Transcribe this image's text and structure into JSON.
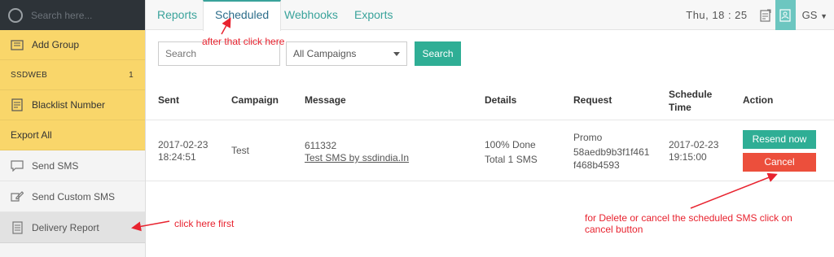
{
  "sidebar": {
    "search_placeholder": "Search here...",
    "add_group": "Add Group",
    "group_name": "SSDWEB",
    "group_count": "1",
    "blacklist": "Blacklist Number",
    "export_all": "Export All",
    "send_sms": "Send SMS",
    "send_custom_sms": "Send Custom SMS",
    "delivery_report": "Delivery Report"
  },
  "tabs": [
    "Reports",
    "Scheduled",
    "Webhooks",
    "Exports"
  ],
  "header": {
    "clock": "Thu, 18 : 25",
    "user": "GS"
  },
  "filters": {
    "search_placeholder": "Search",
    "campaign_select": "All Campaigns",
    "search_button": "Search"
  },
  "table": {
    "headers": {
      "sent": "Sent",
      "campaign": "Campaign",
      "message": "Message",
      "details": "Details",
      "request": "Request",
      "schedule_line1": "Schedule",
      "schedule_line2": "Time",
      "action": "Action"
    },
    "row": {
      "sent_date": "2017-02-23",
      "sent_time": "18:24:51",
      "campaign": "Test",
      "message_id": "611332",
      "message_text": "Test SMS by ssdindia.In",
      "details_status": "100% Done",
      "details_total": "Total 1 SMS",
      "request_type": "Promo",
      "request_id_1": "58aedb9b3f1f461",
      "request_id_2": "f468b4593",
      "schedule_date": "2017-02-23",
      "schedule_time": "19:15:00",
      "resend_label": "Resend now",
      "cancel_label": "Cancel"
    }
  },
  "annotations": {
    "after_that": "after that click here",
    "click_first": "click here first",
    "cancel_note_1": "for Delete or cancel the scheduled SMS click on",
    "cancel_note_2": "cancel button"
  },
  "colors": {
    "accent": "#2fae95",
    "danger": "#ec4f3c",
    "sidebar_yellow": "#f9d66a",
    "annotation": "#e8232f"
  }
}
